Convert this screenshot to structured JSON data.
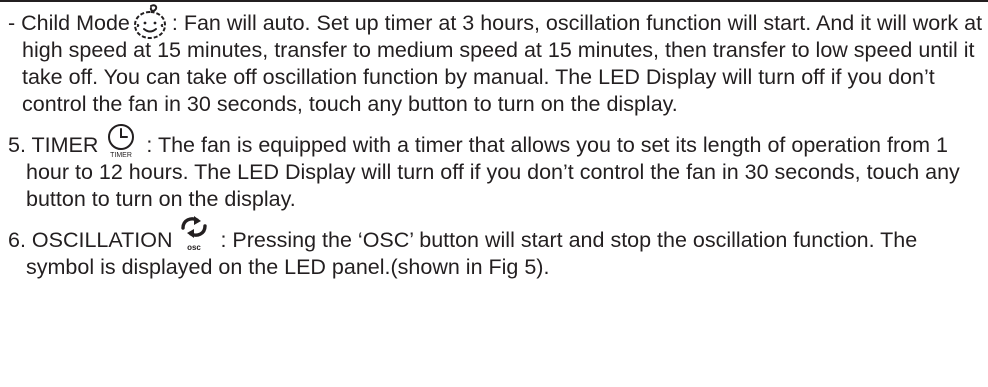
{
  "child_mode": {
    "lead": "- Child Mode",
    "icon": "child-face-icon",
    "text": ": Fan will auto. Set up timer at 3 hours, oscillation function will start. And it will work at high speed at 15 minutes, transfer to medium speed at 15 minutes, then transfer to low speed until it take off.  You can take off oscillation function by manual. The LED Display will turn off if you don’t control the fan in 30 seconds, touch any button to turn on the display."
  },
  "timer": {
    "lead": "5. TIMER",
    "icon": "clock-icon",
    "icon_label": "TIMER",
    "text": ": The fan is equipped with a timer that allows you to set its length of operation from 1 hour to 12 hours. The LED Display will turn off if you don’t control the fan in 30 seconds, touch any button to turn on the display."
  },
  "oscillation": {
    "lead": "6. OSCILLATION",
    "icon": "oscillation-arrows-icon",
    "icon_label": "osc",
    "text": ": Pressing the ‘OSC’ button will start and stop the oscillation function. The symbol is displayed on the LED panel.(shown in Fig 5)."
  }
}
